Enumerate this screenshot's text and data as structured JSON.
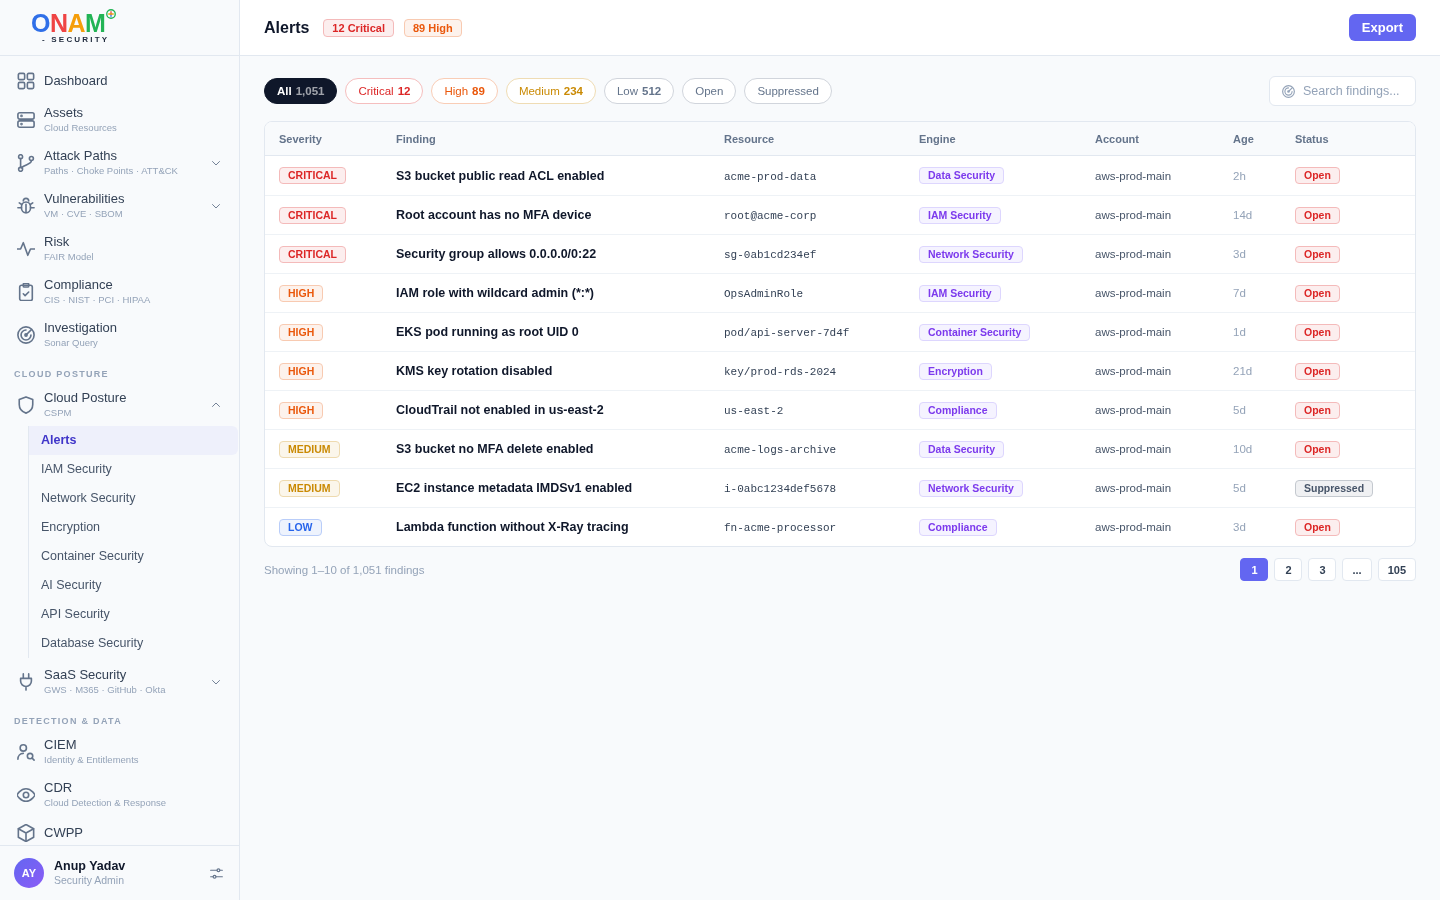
{
  "sidebar": {
    "logo": {
      "wordmark": "ONAM",
      "tagline": "- SECURITY"
    },
    "sections": [
      {
        "items": [
          {
            "kind": "link",
            "title": "Dashboard"
          },
          {
            "kind": "link",
            "title": "Assets",
            "subtitle": "Cloud Resources"
          },
          {
            "kind": "group",
            "title": "Attack Paths",
            "subtitle": "Paths · Choke Points · ATT&CK",
            "expanded": false
          },
          {
            "kind": "group",
            "title": "Vulnerabilities",
            "subtitle": "VM · CVE · SBOM",
            "expanded": false
          },
          {
            "kind": "link",
            "title": "Risk",
            "subtitle": "FAIR Model"
          },
          {
            "kind": "link",
            "title": "Compliance",
            "subtitle": "CIS · NIST · PCI · HIPAA"
          },
          {
            "kind": "link",
            "title": "Investigation",
            "subtitle": "Sonar Query"
          }
        ]
      },
      {
        "label": "CLOUD POSTURE",
        "items": [
          {
            "kind": "group",
            "title": "Cloud Posture",
            "subtitle": "CSPM",
            "expanded": true,
            "children": [
              {
                "label": "Alerts",
                "selected": true
              },
              {
                "label": "IAM Security",
                "selected": false
              },
              {
                "label": "Network Security",
                "selected": false
              },
              {
                "label": "Encryption",
                "selected": false
              },
              {
                "label": "Container Security",
                "selected": false
              },
              {
                "label": "AI Security",
                "selected": false
              },
              {
                "label": "API Security",
                "selected": false
              },
              {
                "label": "Database Security",
                "selected": false
              }
            ]
          },
          {
            "kind": "group",
            "title": "SaaS Security",
            "subtitle": "GWS · M365 · GitHub · Okta",
            "expanded": false
          }
        ]
      },
      {
        "label": "DETECTION & DATA",
        "items": [
          {
            "kind": "link",
            "title": "CIEM",
            "subtitle": "Identity & Entitlements"
          },
          {
            "kind": "link",
            "title": "CDR",
            "subtitle": "Cloud Detection & Response"
          },
          {
            "kind": "link",
            "title": "CWPP"
          }
        ]
      }
    ],
    "user": {
      "initials": "AY",
      "name": "Anup Yadav",
      "role": "Security Admin"
    }
  },
  "header": {
    "title": "Alerts",
    "badges": [
      {
        "label": "12 Critical",
        "color": "#dc2626"
      },
      {
        "label": "89 High",
        "color": "#ea580c"
      }
    ],
    "export_button": "Export"
  },
  "filters": {
    "chips": [
      {
        "label": "All",
        "count": "1,051",
        "selected": true,
        "color": "#0f172a"
      },
      {
        "label": "Critical",
        "count": "12",
        "selected": false,
        "color": "#dc2626"
      },
      {
        "label": "High",
        "count": "89",
        "selected": false,
        "color": "#ea580c"
      },
      {
        "label": "Medium",
        "count": "234",
        "selected": false,
        "color": "#ca8a04"
      },
      {
        "label": "Low",
        "count": "512",
        "selected": false,
        "color": "#64748b"
      },
      {
        "label": "Open",
        "selected": false,
        "color": "#64748b"
      },
      {
        "label": "Suppressed",
        "selected": false,
        "color": "#64748b"
      }
    ],
    "search": {
      "placeholder": "Search findings..."
    }
  },
  "table": {
    "columns": [
      "Severity",
      "Finding",
      "Resource",
      "Engine",
      "Account",
      "Age",
      "Status"
    ],
    "rows": [
      {
        "severity": {
          "label": "CRITICAL",
          "color": "#dc2626"
        },
        "finding": "S3 bucket public read ACL enabled",
        "resource": "acme-prod-data",
        "engine": "Data Security",
        "account": "aws-prod-main",
        "age": "2h",
        "status": {
          "label": "Open",
          "color": "#dc2626"
        }
      },
      {
        "severity": {
          "label": "CRITICAL",
          "color": "#dc2626"
        },
        "finding": "Root account has no MFA device",
        "resource": "root@acme-corp",
        "engine": "IAM Security",
        "account": "aws-prod-main",
        "age": "14d",
        "status": {
          "label": "Open",
          "color": "#dc2626"
        }
      },
      {
        "severity": {
          "label": "CRITICAL",
          "color": "#dc2626"
        },
        "finding": "Security group allows 0.0.0.0/0:22",
        "resource": "sg-0ab1cd234ef",
        "engine": "Network Security",
        "account": "aws-prod-main",
        "age": "3d",
        "status": {
          "label": "Open",
          "color": "#dc2626"
        }
      },
      {
        "severity": {
          "label": "HIGH",
          "color": "#ea580c"
        },
        "finding": "IAM role with wildcard admin (*:*)",
        "resource": "OpsAdminRole",
        "engine": "IAM Security",
        "account": "aws-prod-main",
        "age": "7d",
        "status": {
          "label": "Open",
          "color": "#dc2626"
        }
      },
      {
        "severity": {
          "label": "HIGH",
          "color": "#ea580c"
        },
        "finding": "EKS pod running as root UID 0",
        "resource": "pod/api-server-7d4f",
        "engine": "Container Security",
        "account": "aws-prod-main",
        "age": "1d",
        "status": {
          "label": "Open",
          "color": "#dc2626"
        }
      },
      {
        "severity": {
          "label": "HIGH",
          "color": "#ea580c"
        },
        "finding": "KMS key rotation disabled",
        "resource": "key/prod-rds-2024",
        "engine": "Encryption",
        "account": "aws-prod-main",
        "age": "21d",
        "status": {
          "label": "Open",
          "color": "#dc2626"
        }
      },
      {
        "severity": {
          "label": "HIGH",
          "color": "#ea580c"
        },
        "finding": "CloudTrail not enabled in us-east-2",
        "resource": "us-east-2",
        "engine": "Compliance",
        "account": "aws-prod-main",
        "age": "5d",
        "status": {
          "label": "Open",
          "color": "#dc2626"
        }
      },
      {
        "severity": {
          "label": "MEDIUM",
          "color": "#ca8a04"
        },
        "finding": "S3 bucket no MFA delete enabled",
        "resource": "acme-logs-archive",
        "engine": "Data Security",
        "account": "aws-prod-main",
        "age": "10d",
        "status": {
          "label": "Open",
          "color": "#dc2626"
        }
      },
      {
        "severity": {
          "label": "MEDIUM",
          "color": "#ca8a04"
        },
        "finding": "EC2 instance metadata IMDSv1 enabled",
        "resource": "i-0abc1234def5678",
        "engine": "Network Security",
        "account": "aws-prod-main",
        "age": "5d",
        "status": {
          "label": "Suppressed",
          "color": "#475569"
        }
      },
      {
        "severity": {
          "label": "LOW",
          "color": "#2563eb"
        },
        "finding": "Lambda function without X-Ray tracing",
        "resource": "fn-acme-processor",
        "engine": "Compliance",
        "account": "aws-prod-main",
        "age": "3d",
        "status": {
          "label": "Open",
          "color": "#dc2626"
        }
      }
    ]
  },
  "footer": {
    "summary": "Showing 1–10 of 1,051 findings",
    "pages": [
      {
        "label": "1",
        "selected": true
      },
      {
        "label": "2",
        "selected": false
      },
      {
        "label": "3",
        "selected": false
      },
      {
        "label": "...",
        "selected": false
      },
      {
        "label": "105",
        "selected": false
      }
    ]
  }
}
